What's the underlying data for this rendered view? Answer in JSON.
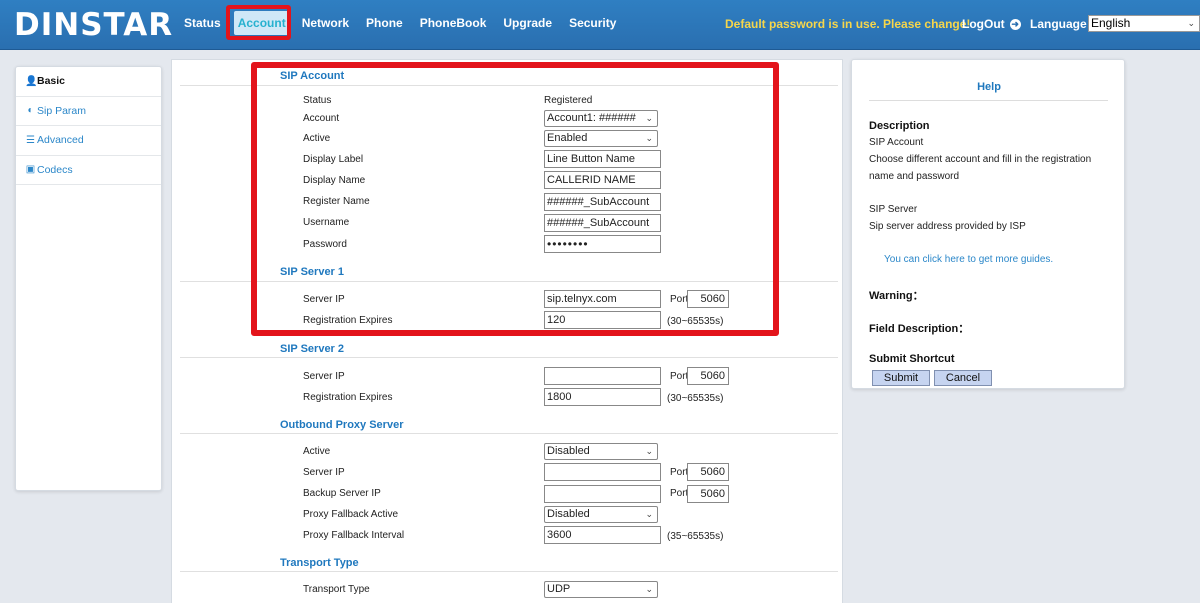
{
  "brand": "DINSTAR",
  "nav": [
    "Status",
    "Account",
    "Network",
    "Phone",
    "PhoneBook",
    "Upgrade",
    "Security"
  ],
  "header": {
    "warning": "Default password is in use. Please change!",
    "logout": "LogOut",
    "language_label": "Language",
    "language_value": "English"
  },
  "sidebar": [
    {
      "label": "Basic",
      "icon": "user-icon"
    },
    {
      "label": "Sip Param",
      "icon": "half-circle-icon"
    },
    {
      "label": "Advanced",
      "icon": "list-icon"
    },
    {
      "label": "Codecs",
      "icon": "codecs-icon"
    }
  ],
  "sip_account": {
    "title": "SIP Account",
    "status_label": "Status",
    "status_value": "Registered",
    "account_label": "Account",
    "account_value": "Account1: ######",
    "active_label": "Active",
    "active_value": "Enabled",
    "display_label_label": "Display Label",
    "display_label_value": "Line Button Name",
    "display_name_label": "Display Name",
    "display_name_value": "CALLERID NAME",
    "register_name_label": "Register Name",
    "register_name_value": "######_SubAccount",
    "username_label": "Username",
    "username_value": "######_SubAccount",
    "password_label": "Password",
    "password_value": "••••••••"
  },
  "sip_server1": {
    "title": "SIP Server 1",
    "server_ip_label": "Server IP",
    "server_ip_value": "sip.telnyx.com",
    "port_label": "Port",
    "port_value": "5060",
    "expires_label": "Registration Expires",
    "expires_value": "120",
    "expires_range": "(30~65535s)"
  },
  "sip_server2": {
    "title": "SIP Server 2",
    "server_ip_label": "Server IP",
    "server_ip_value": "",
    "port_label": "Port",
    "port_value": "5060",
    "expires_label": "Registration Expires",
    "expires_value": "1800",
    "expires_range": "(30~65535s)"
  },
  "outbound_proxy": {
    "title": "Outbound Proxy Server",
    "active_label": "Active",
    "active_value": "Disabled",
    "server_ip_label": "Server IP",
    "server_ip_value": "",
    "port_label": "Port",
    "port_value": "5060",
    "backup_ip_label": "Backup Server IP",
    "backup_ip_value": "",
    "backup_port_label": "Port",
    "backup_port_value": "5060",
    "fallback_active_label": "Proxy Fallback Active",
    "fallback_active_value": "Disabled",
    "fallback_interval_label": "Proxy Fallback Interval",
    "fallback_interval_value": "3600",
    "fallback_interval_range": "(35~65535s)"
  },
  "transport": {
    "title": "Transport Type",
    "type_label": "Transport Type",
    "type_value": "UDP"
  },
  "help": {
    "title": "Help",
    "description_head": "Description",
    "sip_account_head": "SIP Account",
    "sip_account_text": "Choose different account and fill in the registration name and password",
    "sip_server_head": "SIP Server",
    "sip_server_text": "Sip server address provided by ISP",
    "guide_link": "You can click here to get more guides.",
    "warning_head": "Warning：",
    "field_desc_head": "Field Description：",
    "submit_shortcut_head": "Submit Shortcut",
    "submit_label": "Submit",
    "cancel_label": "Cancel"
  },
  "colors": {
    "header": "#2a6fb0",
    "accent": "#1f78be",
    "warning": "#f6d64b",
    "highlight": "#e3141b"
  }
}
